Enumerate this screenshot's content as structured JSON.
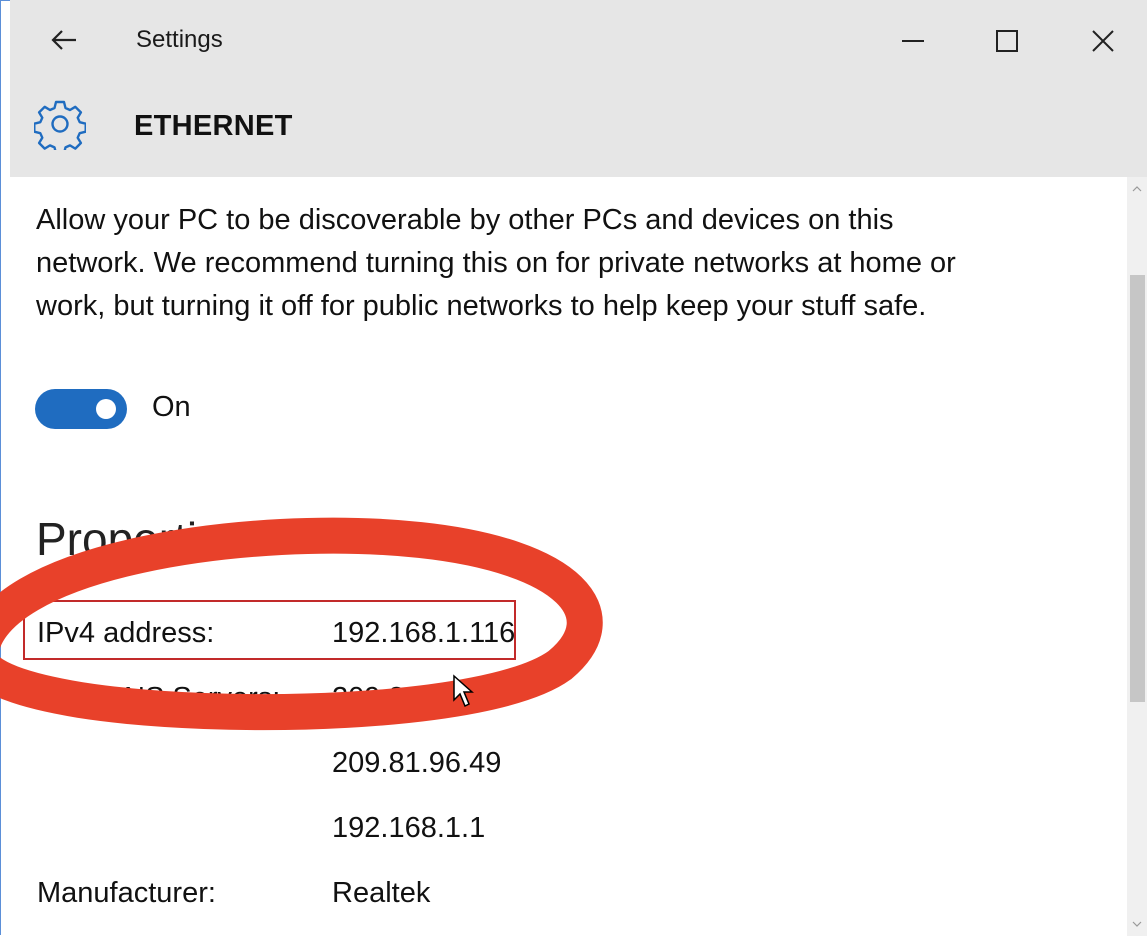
{
  "window": {
    "title": "Settings",
    "back_icon": "back-arrow-icon",
    "minimize_icon": "minimize-icon",
    "maximize_icon": "maximize-icon",
    "close_icon": "close-icon"
  },
  "header": {
    "icon": "gear-icon",
    "title": "ETHERNET"
  },
  "discovery": {
    "description": "Allow your PC to be discoverable by other PCs and devices on this network. We recommend turning this on for private networks at home or work, but turning it off for public networks to help keep your stuff safe.",
    "toggle_state": "On",
    "toggle_color": "#1f6cc0"
  },
  "properties": {
    "title": "Properties",
    "rows": [
      {
        "label": "IPv4 address:",
        "value": "192.168.1.116"
      },
      {
        "label": "IPv4 DNS Servers:",
        "value": "209.81.96.30"
      },
      {
        "label": "",
        "value": "209.81.96.49"
      },
      {
        "label": "",
        "value": "192.168.1.1"
      },
      {
        "label": "Manufacturer:",
        "value": "Realtek"
      }
    ]
  },
  "annotation": {
    "highlight_color": "#e8412a",
    "box_color": "#c22a2a"
  }
}
